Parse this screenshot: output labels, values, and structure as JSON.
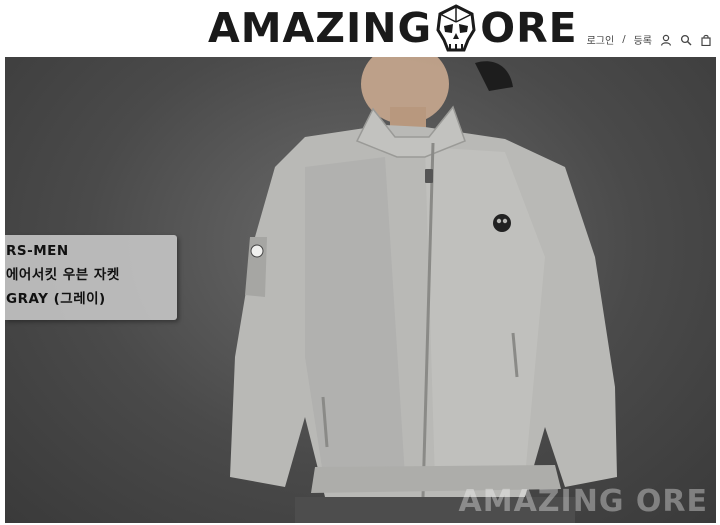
{
  "header": {
    "logo_left": "AMAZING",
    "logo_right": "ORE",
    "nav": {
      "login": "로그인",
      "separator": "/",
      "register": "등록"
    }
  },
  "hero": {
    "caption": {
      "line1": "RS-MEN",
      "line2": "에어서킷 우븐 자켓",
      "line3": "GRAY (그레이)"
    },
    "watermark": "AMAZING ORE"
  },
  "colors": {
    "background": "#4a4a4a",
    "jacket": "#b9b9b6",
    "caption_box": "#c8c8c8"
  }
}
